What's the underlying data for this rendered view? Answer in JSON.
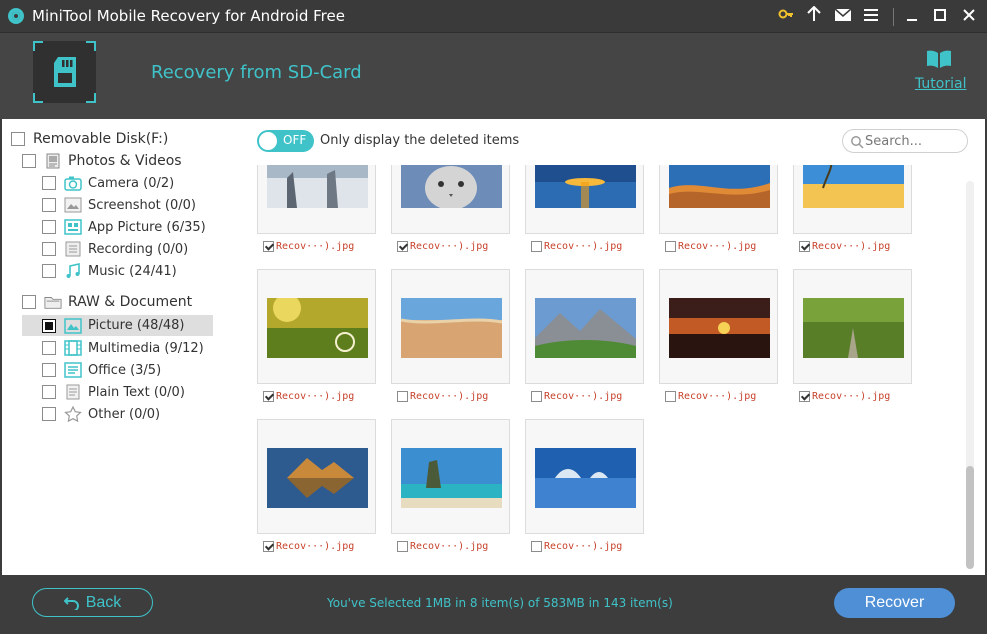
{
  "window": {
    "title": "MiniTool Mobile Recovery for Android Free"
  },
  "header": {
    "title": "Recovery from SD-Card",
    "tutorial": "Tutorial"
  },
  "tree": {
    "root": "Removable Disk(F:)",
    "groups": [
      {
        "label": "Photos & Videos",
        "items": [
          {
            "label": "Camera (0/2)"
          },
          {
            "label": "Screenshot (0/0)"
          },
          {
            "label": "App Picture (6/35)"
          },
          {
            "label": "Recording (0/0)"
          },
          {
            "label": "Music (24/41)"
          }
        ]
      },
      {
        "label": "RAW & Document",
        "items": [
          {
            "label": "Picture (48/48)"
          },
          {
            "label": "Multimedia (9/12)"
          },
          {
            "label": "Office (3/5)"
          },
          {
            "label": "Plain Text (0/0)"
          },
          {
            "label": "Other (0/0)"
          }
        ]
      }
    ]
  },
  "filter": {
    "toggle": "OFF",
    "label": "Only display the deleted items"
  },
  "search": {
    "placeholder": "Search..."
  },
  "thumbnails": [
    {
      "caption": "Recov···).jpg",
      "checked": true
    },
    {
      "caption": "Recov···).jpg",
      "checked": true
    },
    {
      "caption": "Recov···).jpg",
      "checked": false
    },
    {
      "caption": "Recov···).jpg",
      "checked": false
    },
    {
      "caption": "Recov···).jpg",
      "checked": true
    },
    {
      "caption": "Recov···).jpg",
      "checked": true
    },
    {
      "caption": "Recov···).jpg",
      "checked": false
    },
    {
      "caption": "Recov···).jpg",
      "checked": false
    },
    {
      "caption": "Recov···).jpg",
      "checked": false
    },
    {
      "caption": "Recov···).jpg",
      "checked": true
    },
    {
      "caption": "Recov···).jpg",
      "checked": true
    },
    {
      "caption": "Recov···).jpg",
      "checked": false
    },
    {
      "caption": "Recov···).jpg",
      "checked": false
    }
  ],
  "footer": {
    "back": "Back",
    "status": "You've Selected 1MB in 8 item(s) of 583MB in 143 item(s)",
    "recover": "Recover"
  },
  "colors": {
    "accent": "#3fc3c9",
    "recover": "#4f8fd6",
    "caption": "#c7412a"
  }
}
